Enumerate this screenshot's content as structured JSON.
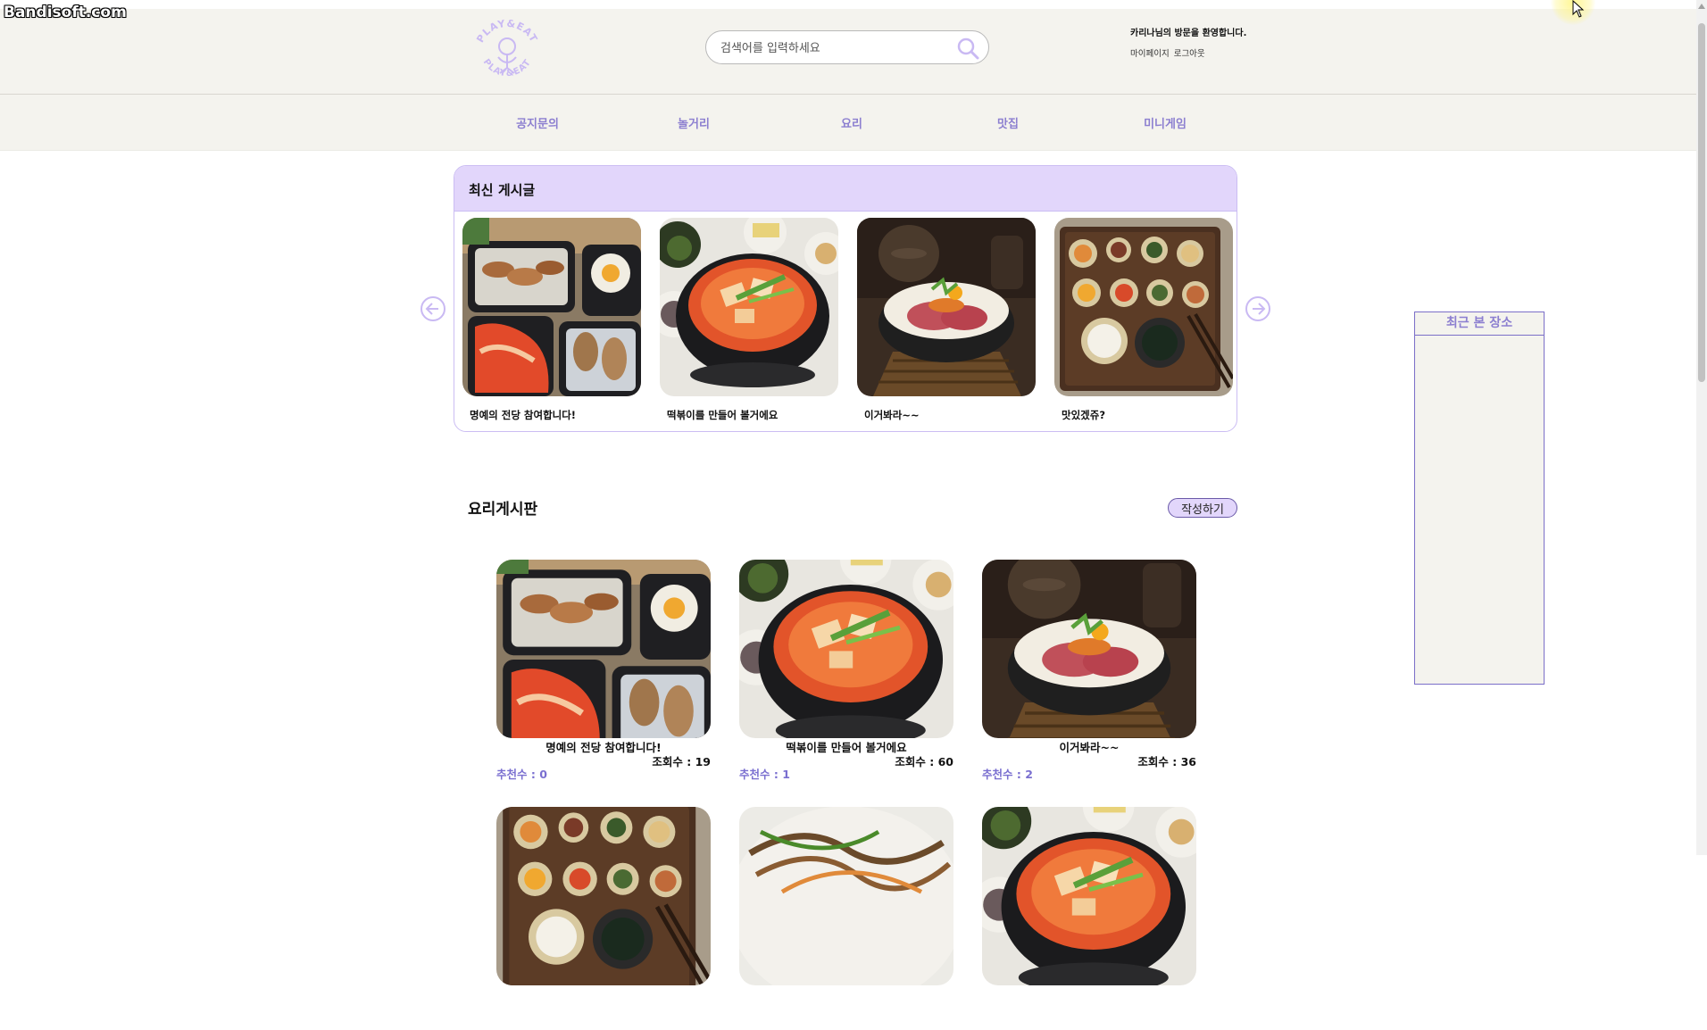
{
  "watermark": "Bandisoft.com",
  "header": {
    "logo_text": "PLAY&EAT",
    "search": {
      "placeholder": "검색어를 입력하세요"
    },
    "welcome": "카리나님의 방문을 환영합니다.",
    "links": [
      "마이페이지",
      "로그아웃"
    ]
  },
  "nav": {
    "items": [
      "공지문의",
      "놀거리",
      "요리",
      "맛집",
      "미니게임"
    ]
  },
  "recent_posts": {
    "title": "최신 게시글",
    "items": [
      {
        "caption": "명예의 전당 참여합니다!",
        "image": "grilled-meat-kimchi-boxes"
      },
      {
        "caption": "떡볶이를 만들어 볼거에요",
        "image": "kimchi-stew-pot"
      },
      {
        "caption": "이거봐라~~",
        "image": "beef-rice-bowl"
      },
      {
        "caption": "맛있겠쥬?",
        "image": "korean-side-dishes-tray"
      }
    ]
  },
  "board": {
    "title": "요리게시판",
    "write_label": "작성하기",
    "posts": [
      {
        "title": "명예의 전당 참여합니다!",
        "views": "조회수 : 19",
        "likes": "추천수 : 0",
        "image": "grilled-meat-kimchi-boxes"
      },
      {
        "title": "떡볶이를 만들어 볼거에요",
        "views": "조회수 : 60",
        "likes": "추천수 : 1",
        "image": "kimchi-stew-pot"
      },
      {
        "title": "이거봐라~~",
        "views": "조회수 : 36",
        "likes": "추천수 : 2",
        "image": "beef-rice-bowl"
      }
    ],
    "more_images": [
      "korean-side-dishes-tray",
      "japchae-noodles",
      "kimchi-stew-pot"
    ]
  },
  "sidebar": {
    "title": "최근 본 장소"
  },
  "colors": {
    "accent": "#8c7fd0",
    "header_bg": "#f4f3ee",
    "panel_head": "#e2d6fb",
    "panel_border": "#cbbdf3"
  }
}
